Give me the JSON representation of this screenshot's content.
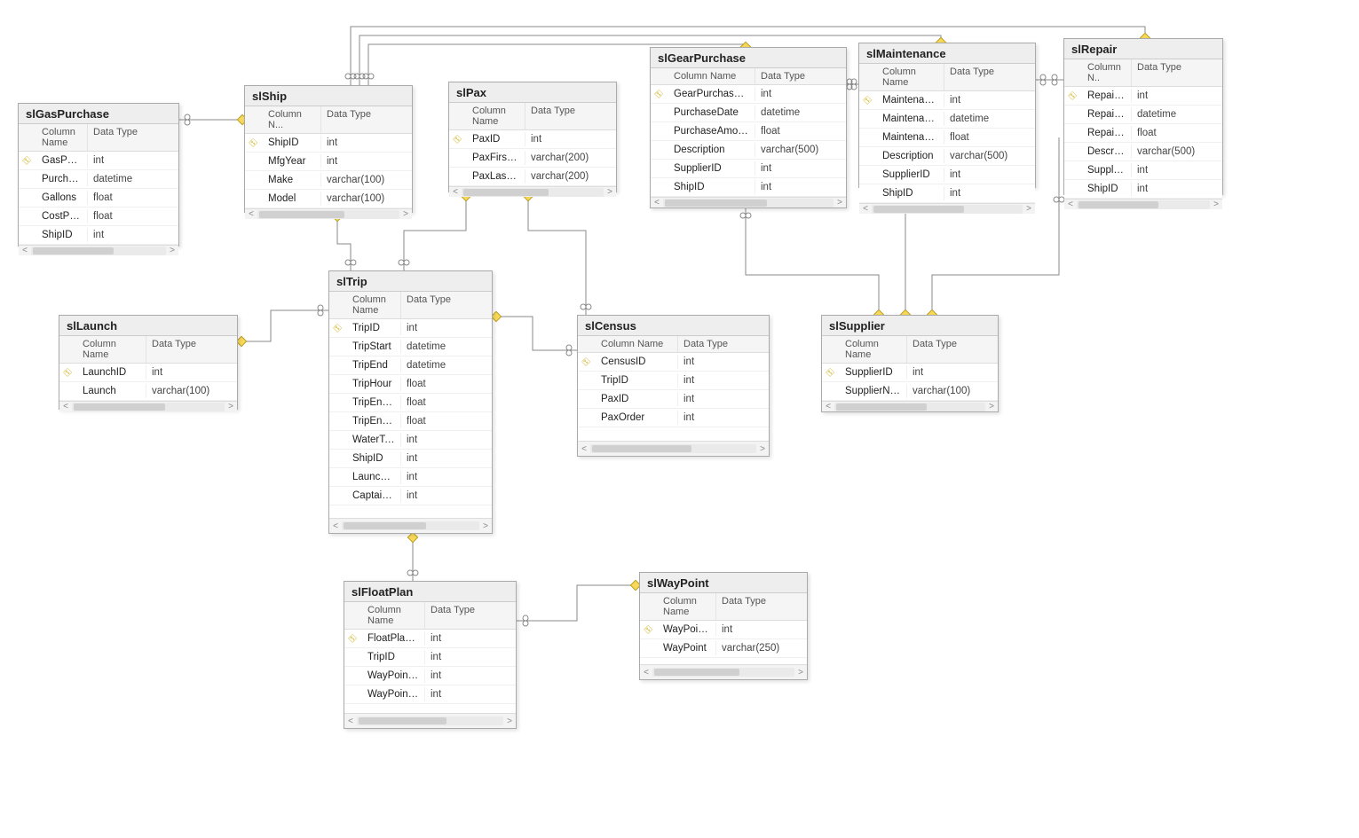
{
  "headers": {
    "column_name": "Column Name",
    "column_name_short": "Column N...",
    "column_name_short2": "Column N..",
    "data_type": "Data Type"
  },
  "tables": {
    "slGasPurchase": {
      "title": "slGasPurchase",
      "columns": [
        {
          "pk": true,
          "name": "GasPurchaseID",
          "type": "int"
        },
        {
          "pk": false,
          "name": "PurchaseDate",
          "type": "datetime"
        },
        {
          "pk": false,
          "name": "Gallons",
          "type": "float"
        },
        {
          "pk": false,
          "name": "CostPerGallon",
          "type": "float"
        },
        {
          "pk": false,
          "name": "ShipID",
          "type": "int"
        }
      ]
    },
    "slShip": {
      "title": "slShip",
      "columns": [
        {
          "pk": true,
          "name": "ShipID",
          "type": "int"
        },
        {
          "pk": false,
          "name": "MfgYear",
          "type": "int"
        },
        {
          "pk": false,
          "name": "Make",
          "type": "varchar(100)"
        },
        {
          "pk": false,
          "name": "Model",
          "type": "varchar(100)"
        }
      ]
    },
    "slPax": {
      "title": "slPax",
      "columns": [
        {
          "pk": true,
          "name": "PaxID",
          "type": "int"
        },
        {
          "pk": false,
          "name": "PaxFirstName",
          "type": "varchar(200)"
        },
        {
          "pk": false,
          "name": "PaxLastName",
          "type": "varchar(200)"
        }
      ]
    },
    "slGearPurchase": {
      "title": "slGearPurchase",
      "columns": [
        {
          "pk": true,
          "name": "GearPurchaseID",
          "type": "int"
        },
        {
          "pk": false,
          "name": "PurchaseDate",
          "type": "datetime"
        },
        {
          "pk": false,
          "name": "PurchaseAmount",
          "type": "float"
        },
        {
          "pk": false,
          "name": "Description",
          "type": "varchar(500)"
        },
        {
          "pk": false,
          "name": "SupplierID",
          "type": "int"
        },
        {
          "pk": false,
          "name": "ShipID",
          "type": "int"
        }
      ]
    },
    "slMaintenance": {
      "title": "slMaintenance",
      "columns": [
        {
          "pk": true,
          "name": "MaintenanceID",
          "type": "int"
        },
        {
          "pk": false,
          "name": "MaintenanceDate",
          "type": "datetime"
        },
        {
          "pk": false,
          "name": "MaintenanceCost",
          "type": "float"
        },
        {
          "pk": false,
          "name": "Description",
          "type": "varchar(500)"
        },
        {
          "pk": false,
          "name": "SupplierID",
          "type": "int"
        },
        {
          "pk": false,
          "name": "ShipID",
          "type": "int"
        }
      ]
    },
    "slRepair": {
      "title": "slRepair",
      "columns": [
        {
          "pk": true,
          "name": "RepairID",
          "type": "int"
        },
        {
          "pk": false,
          "name": "RepairDate",
          "type": "datetime"
        },
        {
          "pk": false,
          "name": "RepairCost",
          "type": "float"
        },
        {
          "pk": false,
          "name": "Description",
          "type": "varchar(500)"
        },
        {
          "pk": false,
          "name": "SupplierID",
          "type": "int"
        },
        {
          "pk": false,
          "name": "ShipID",
          "type": "int"
        }
      ]
    },
    "slLaunch": {
      "title": "slLaunch",
      "columns": [
        {
          "pk": true,
          "name": "LaunchID",
          "type": "int"
        },
        {
          "pk": false,
          "name": "Launch",
          "type": "varchar(100)"
        }
      ]
    },
    "slTrip": {
      "title": "slTrip",
      "columns": [
        {
          "pk": true,
          "name": "TripID",
          "type": "int"
        },
        {
          "pk": false,
          "name": "TripStart",
          "type": "datetime"
        },
        {
          "pk": false,
          "name": "TripEnd",
          "type": "datetime"
        },
        {
          "pk": false,
          "name": "TripHour",
          "type": "float"
        },
        {
          "pk": false,
          "name": "TripEngineStart",
          "type": "float"
        },
        {
          "pk": false,
          "name": "TripEngineEnd",
          "type": "float"
        },
        {
          "pk": false,
          "name": "WaterTemp",
          "type": "int"
        },
        {
          "pk": false,
          "name": "ShipID",
          "type": "int"
        },
        {
          "pk": false,
          "name": "LaunchID",
          "type": "int"
        },
        {
          "pk": false,
          "name": "CaptainID",
          "type": "int"
        }
      ]
    },
    "slCensus": {
      "title": "slCensus",
      "columns": [
        {
          "pk": true,
          "name": "CensusID",
          "type": "int"
        },
        {
          "pk": false,
          "name": "TripID",
          "type": "int"
        },
        {
          "pk": false,
          "name": "PaxID",
          "type": "int"
        },
        {
          "pk": false,
          "name": "PaxOrder",
          "type": "int"
        }
      ]
    },
    "slSupplier": {
      "title": "slSupplier",
      "columns": [
        {
          "pk": true,
          "name": "SupplierID",
          "type": "int"
        },
        {
          "pk": false,
          "name": "SupplierName",
          "type": "varchar(100)"
        }
      ]
    },
    "slFloatPlan": {
      "title": "slFloatPlan",
      "columns": [
        {
          "pk": true,
          "name": "FloatPlanID",
          "type": "int"
        },
        {
          "pk": false,
          "name": "TripID",
          "type": "int"
        },
        {
          "pk": false,
          "name": "WayPointID",
          "type": "int"
        },
        {
          "pk": false,
          "name": "WayPointOrder",
          "type": "int"
        }
      ]
    },
    "slWayPoint": {
      "title": "slWayPoint",
      "columns": [
        {
          "pk": true,
          "name": "WayPointID",
          "type": "int"
        },
        {
          "pk": false,
          "name": "WayPoint",
          "type": "varchar(250)"
        }
      ]
    }
  }
}
